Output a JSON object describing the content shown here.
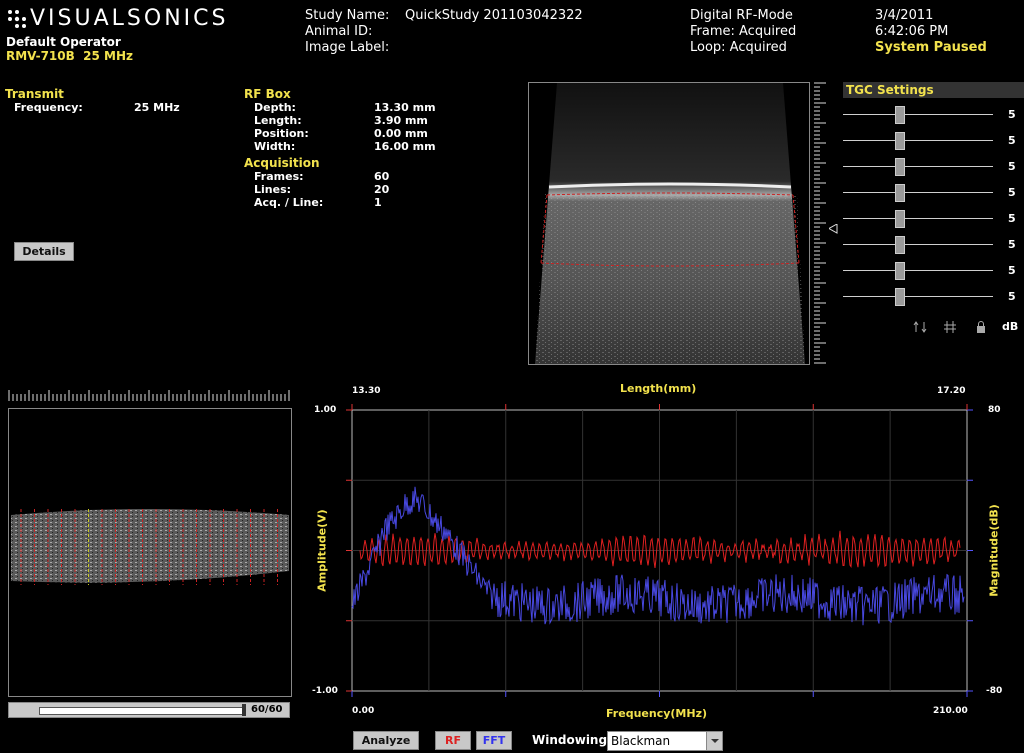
{
  "brand": {
    "logo_text": "VISUALSONICS",
    "operator": "Default Operator",
    "probe": "RMV-710B  25 MHz"
  },
  "study": {
    "study_name_label": "Study Name:",
    "study_name": "QuickStudy 201103042322",
    "animal_id_label": "Animal ID:",
    "image_label_label": "Image Label:"
  },
  "mode": {
    "mode": "Digital RF-Mode",
    "frame": "Frame: Acquired",
    "loop": "Loop: Acquired"
  },
  "datetime": {
    "date": "3/4/2011",
    "time": "6:42:06 PM",
    "status": "System Paused"
  },
  "transmit": {
    "title": "Transmit",
    "freq_label": "Frequency:",
    "freq_value": "25 MHz"
  },
  "rfbox": {
    "title": "RF Box",
    "rows": [
      {
        "label": "Depth:",
        "value": "13.30 mm"
      },
      {
        "label": "Length:",
        "value": "3.90 mm"
      },
      {
        "label": "Position:",
        "value": "0.00 mm"
      },
      {
        "label": "Width:",
        "value": "16.00 mm"
      }
    ]
  },
  "acquisition": {
    "title": "Acquisition",
    "rows": [
      {
        "label": "Frames:",
        "value": "60"
      },
      {
        "label": "Lines:",
        "value": "20"
      },
      {
        "label": "Acq. / Line:",
        "value": "1"
      }
    ]
  },
  "details_button": "Details",
  "tgc": {
    "title": "TGC Settings",
    "values": [
      "5",
      "5",
      "5",
      "5",
      "5",
      "5",
      "5",
      "5"
    ],
    "db_label": "dB"
  },
  "frame_slider": {
    "label": "60/60",
    "fraction": 1.0
  },
  "plot": {
    "top_left_label": "13.30",
    "top_right_label": "17.20",
    "top_axis_title": "Length(mm)",
    "bottom_left_label": "0.00",
    "bottom_right_label": "210.00",
    "bottom_axis_title": "Frequency(MHz)",
    "left_top_label": "1.00",
    "left_bottom_label": "-1.00",
    "left_axis_title": "Amplitude(V)",
    "right_top_label": "80",
    "right_bottom_label": "-80",
    "right_axis_title": "Magnitude(dB)"
  },
  "bottom_bar": {
    "analyze": "Analyze",
    "rf": "RF",
    "fft": "FFT",
    "windowing_label": "Windowing",
    "windowing_value": "Blackman"
  },
  "colors": {
    "accent": "#f2e24d",
    "rf_trace": "#e02020",
    "fft_trace": "#4848e0"
  }
}
